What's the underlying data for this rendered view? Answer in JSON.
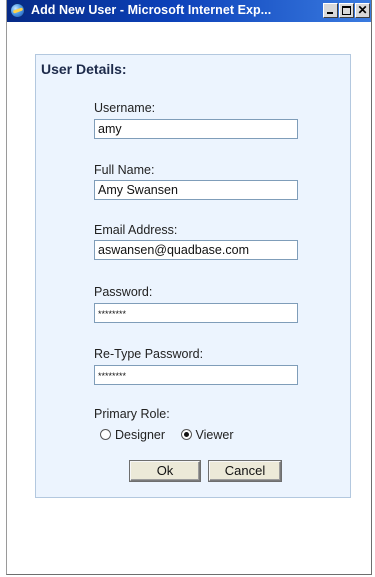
{
  "window": {
    "title": "Add New User - Microsoft Internet Exp...",
    "close_glyph": "✕"
  },
  "form": {
    "section_title": "User Details:",
    "username": {
      "label": "Username:",
      "value": "amy"
    },
    "full_name": {
      "label": "Full Name:",
      "value": "Amy Swansen"
    },
    "email": {
      "label": "Email Address:",
      "value": "aswansen@quadbase.com"
    },
    "password": {
      "label": "Password:",
      "value": "********"
    },
    "retype_password": {
      "label": "Re-Type Password:",
      "value": "********"
    },
    "primary_role": {
      "label": "Primary Role:",
      "options": [
        {
          "label": "Designer",
          "selected": false
        },
        {
          "label": "Viewer",
          "selected": true
        }
      ]
    },
    "ok_label": "Ok",
    "cancel_label": "Cancel"
  },
  "colors": {
    "titlebar": "#0c41b9",
    "panel_bg": "#ecf4fe",
    "panel_border": "#b3c8df"
  },
  "icons": [
    "internet-explorer-icon",
    "minimize-icon",
    "maximize-icon",
    "close-icon"
  ]
}
